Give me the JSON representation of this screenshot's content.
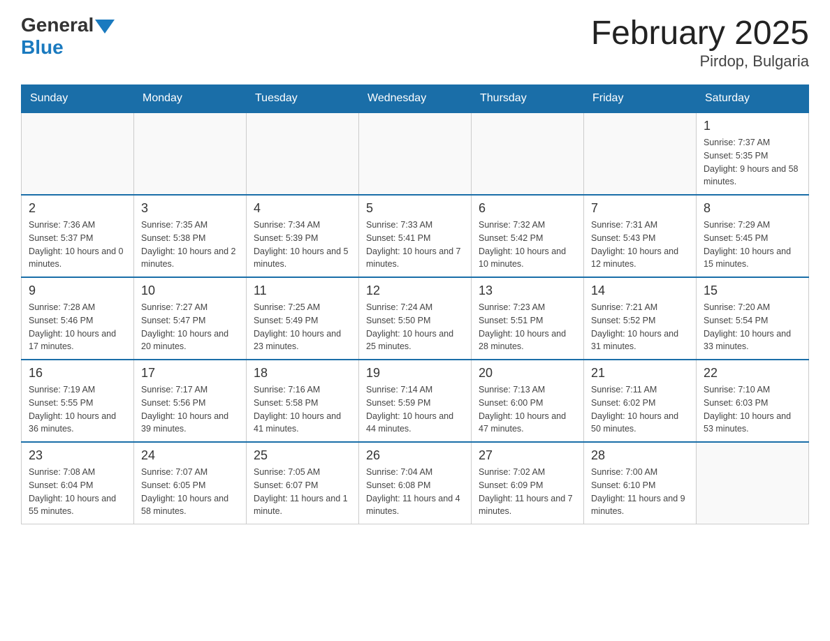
{
  "logo": {
    "general": "General",
    "blue": "Blue"
  },
  "title": "February 2025",
  "location": "Pirdop, Bulgaria",
  "weekdays": [
    "Sunday",
    "Monday",
    "Tuesday",
    "Wednesday",
    "Thursday",
    "Friday",
    "Saturday"
  ],
  "weeks": [
    [
      {
        "day": "",
        "info": ""
      },
      {
        "day": "",
        "info": ""
      },
      {
        "day": "",
        "info": ""
      },
      {
        "day": "",
        "info": ""
      },
      {
        "day": "",
        "info": ""
      },
      {
        "day": "",
        "info": ""
      },
      {
        "day": "1",
        "info": "Sunrise: 7:37 AM\nSunset: 5:35 PM\nDaylight: 9 hours and 58 minutes."
      }
    ],
    [
      {
        "day": "2",
        "info": "Sunrise: 7:36 AM\nSunset: 5:37 PM\nDaylight: 10 hours and 0 minutes."
      },
      {
        "day": "3",
        "info": "Sunrise: 7:35 AM\nSunset: 5:38 PM\nDaylight: 10 hours and 2 minutes."
      },
      {
        "day": "4",
        "info": "Sunrise: 7:34 AM\nSunset: 5:39 PM\nDaylight: 10 hours and 5 minutes."
      },
      {
        "day": "5",
        "info": "Sunrise: 7:33 AM\nSunset: 5:41 PM\nDaylight: 10 hours and 7 minutes."
      },
      {
        "day": "6",
        "info": "Sunrise: 7:32 AM\nSunset: 5:42 PM\nDaylight: 10 hours and 10 minutes."
      },
      {
        "day": "7",
        "info": "Sunrise: 7:31 AM\nSunset: 5:43 PM\nDaylight: 10 hours and 12 minutes."
      },
      {
        "day": "8",
        "info": "Sunrise: 7:29 AM\nSunset: 5:45 PM\nDaylight: 10 hours and 15 minutes."
      }
    ],
    [
      {
        "day": "9",
        "info": "Sunrise: 7:28 AM\nSunset: 5:46 PM\nDaylight: 10 hours and 17 minutes."
      },
      {
        "day": "10",
        "info": "Sunrise: 7:27 AM\nSunset: 5:47 PM\nDaylight: 10 hours and 20 minutes."
      },
      {
        "day": "11",
        "info": "Sunrise: 7:25 AM\nSunset: 5:49 PM\nDaylight: 10 hours and 23 minutes."
      },
      {
        "day": "12",
        "info": "Sunrise: 7:24 AM\nSunset: 5:50 PM\nDaylight: 10 hours and 25 minutes."
      },
      {
        "day": "13",
        "info": "Sunrise: 7:23 AM\nSunset: 5:51 PM\nDaylight: 10 hours and 28 minutes."
      },
      {
        "day": "14",
        "info": "Sunrise: 7:21 AM\nSunset: 5:52 PM\nDaylight: 10 hours and 31 minutes."
      },
      {
        "day": "15",
        "info": "Sunrise: 7:20 AM\nSunset: 5:54 PM\nDaylight: 10 hours and 33 minutes."
      }
    ],
    [
      {
        "day": "16",
        "info": "Sunrise: 7:19 AM\nSunset: 5:55 PM\nDaylight: 10 hours and 36 minutes."
      },
      {
        "day": "17",
        "info": "Sunrise: 7:17 AM\nSunset: 5:56 PM\nDaylight: 10 hours and 39 minutes."
      },
      {
        "day": "18",
        "info": "Sunrise: 7:16 AM\nSunset: 5:58 PM\nDaylight: 10 hours and 41 minutes."
      },
      {
        "day": "19",
        "info": "Sunrise: 7:14 AM\nSunset: 5:59 PM\nDaylight: 10 hours and 44 minutes."
      },
      {
        "day": "20",
        "info": "Sunrise: 7:13 AM\nSunset: 6:00 PM\nDaylight: 10 hours and 47 minutes."
      },
      {
        "day": "21",
        "info": "Sunrise: 7:11 AM\nSunset: 6:02 PM\nDaylight: 10 hours and 50 minutes."
      },
      {
        "day": "22",
        "info": "Sunrise: 7:10 AM\nSunset: 6:03 PM\nDaylight: 10 hours and 53 minutes."
      }
    ],
    [
      {
        "day": "23",
        "info": "Sunrise: 7:08 AM\nSunset: 6:04 PM\nDaylight: 10 hours and 55 minutes."
      },
      {
        "day": "24",
        "info": "Sunrise: 7:07 AM\nSunset: 6:05 PM\nDaylight: 10 hours and 58 minutes."
      },
      {
        "day": "25",
        "info": "Sunrise: 7:05 AM\nSunset: 6:07 PM\nDaylight: 11 hours and 1 minute."
      },
      {
        "day": "26",
        "info": "Sunrise: 7:04 AM\nSunset: 6:08 PM\nDaylight: 11 hours and 4 minutes."
      },
      {
        "day": "27",
        "info": "Sunrise: 7:02 AM\nSunset: 6:09 PM\nDaylight: 11 hours and 7 minutes."
      },
      {
        "day": "28",
        "info": "Sunrise: 7:00 AM\nSunset: 6:10 PM\nDaylight: 11 hours and 9 minutes."
      },
      {
        "day": "",
        "info": ""
      }
    ]
  ]
}
